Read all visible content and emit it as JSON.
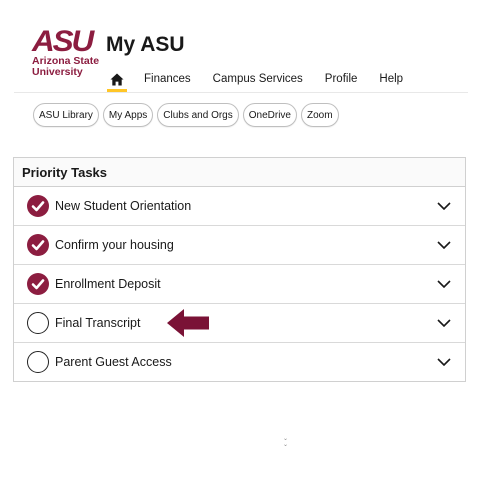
{
  "brand": {
    "logo_mark": "ASU",
    "logo_line1": "Arizona State",
    "logo_line2": "University",
    "accent": "#8c1d40",
    "highlight": "#ffc627"
  },
  "header": {
    "title": "My ASU"
  },
  "nav": {
    "home_icon": "home-icon",
    "items": [
      "Finances",
      "Campus Services",
      "Profile",
      "Help"
    ]
  },
  "quick_links": [
    "ASU Library",
    "My Apps",
    "Clubs and Orgs",
    "OneDrive",
    "Zoom"
  ],
  "priority_tasks": {
    "title": "Priority Tasks",
    "items": [
      {
        "label": "New Student Orientation",
        "status": "complete"
      },
      {
        "label": "Confirm your housing",
        "status": "complete"
      },
      {
        "label": "Enrollment Deposit",
        "status": "complete"
      },
      {
        "label": "Final Transcript",
        "status": "incomplete"
      },
      {
        "label": "Parent Guest Access",
        "status": "incomplete"
      }
    ]
  },
  "annotation": {
    "icon": "arrow-left-icon",
    "color": "#7a1236"
  }
}
